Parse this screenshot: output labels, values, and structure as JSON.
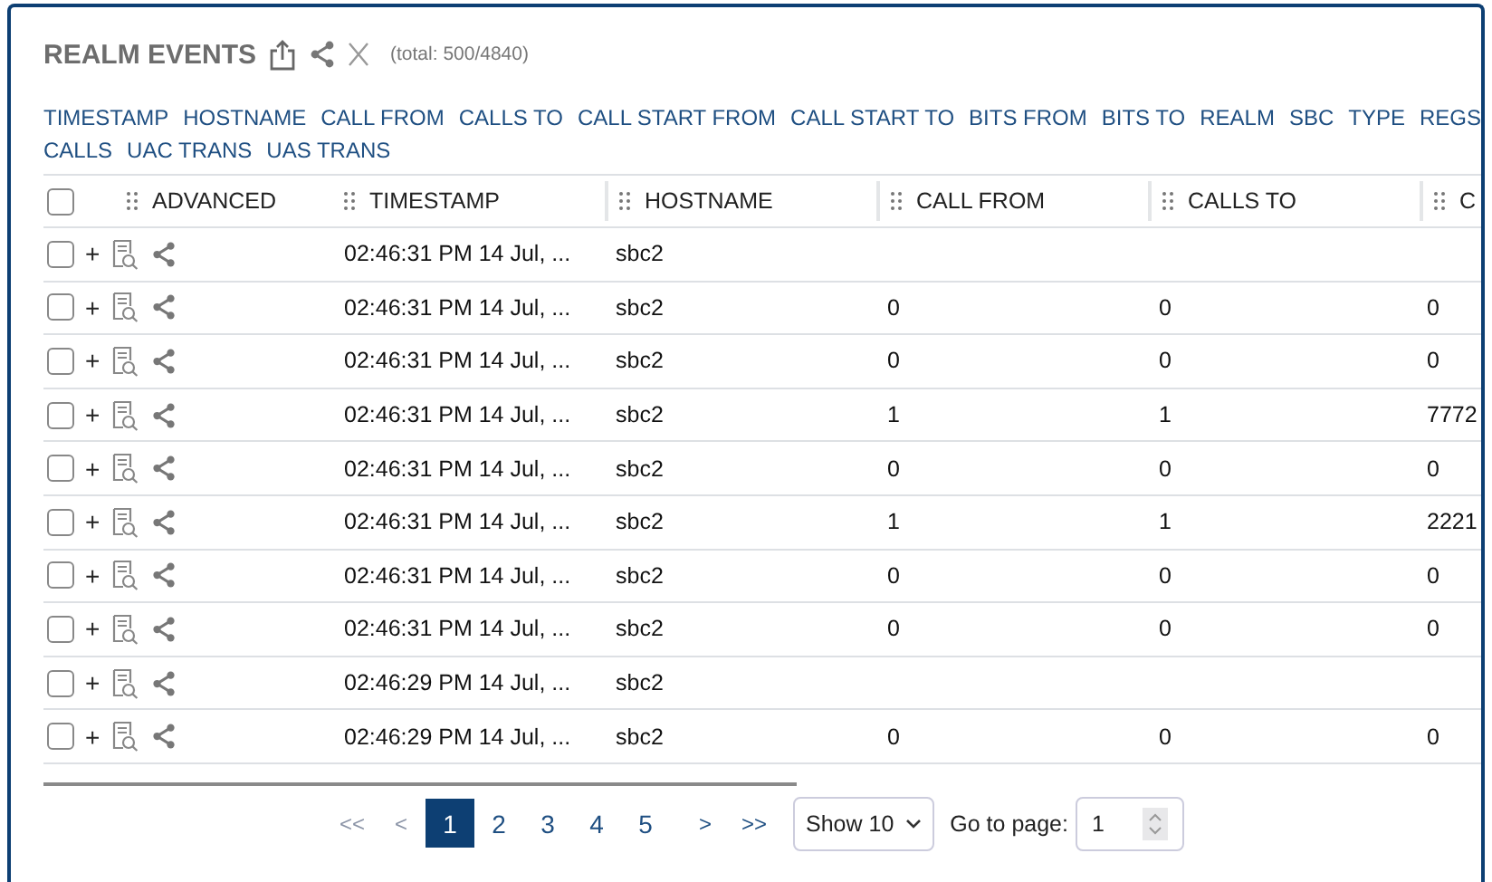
{
  "panel": {
    "title": "REALM EVENTS",
    "total": "(total: 500/4840)"
  },
  "column_picker": [
    "TIMESTAMP",
    "HOSTNAME",
    "CALL FROM",
    "CALLS TO",
    "CALL START FROM",
    "CALL START TO",
    "BITS FROM",
    "BITS TO",
    "REALM",
    "SBC",
    "TYPE",
    "REGS",
    "CALLS",
    "UAC TRANS",
    "UAS TRANS"
  ],
  "table": {
    "select_all": {
      "checked": false
    },
    "columns": [
      "ADVANCED",
      "TIMESTAMP",
      "HOSTNAME",
      "CALL FROM",
      "CALLS TO",
      "C"
    ],
    "rows": [
      {
        "checked": false,
        "expand": "+",
        "timestamp": "02:46:31 PM 14 Jul, ...",
        "hostname": "sbc2",
        "call_from": "",
        "calls_to": "",
        "column_6": ""
      },
      {
        "checked": false,
        "expand": "+",
        "timestamp": "02:46:31 PM 14 Jul, ...",
        "hostname": "sbc2",
        "call_from": "0",
        "calls_to": "0",
        "column_6": "0"
      },
      {
        "checked": false,
        "expand": "+",
        "timestamp": "02:46:31 PM 14 Jul, ...",
        "hostname": "sbc2",
        "call_from": "0",
        "calls_to": "0",
        "column_6": "0"
      },
      {
        "checked": false,
        "expand": "+",
        "timestamp": "02:46:31 PM 14 Jul, ...",
        "hostname": "sbc2",
        "call_from": "1",
        "calls_to": "1",
        "column_6": "7772"
      },
      {
        "checked": false,
        "expand": "+",
        "timestamp": "02:46:31 PM 14 Jul, ...",
        "hostname": "sbc2",
        "call_from": "0",
        "calls_to": "0",
        "column_6": "0"
      },
      {
        "checked": false,
        "expand": "+",
        "timestamp": "02:46:31 PM 14 Jul, ...",
        "hostname": "sbc2",
        "call_from": "1",
        "calls_to": "1",
        "column_6": "2221"
      },
      {
        "checked": false,
        "expand": "+",
        "timestamp": "02:46:31 PM 14 Jul, ...",
        "hostname": "sbc2",
        "call_from": "0",
        "calls_to": "0",
        "column_6": "0"
      },
      {
        "checked": false,
        "expand": "+",
        "timestamp": "02:46:31 PM 14 Jul, ...",
        "hostname": "sbc2",
        "call_from": "0",
        "calls_to": "0",
        "column_6": "0"
      },
      {
        "checked": false,
        "expand": "+",
        "timestamp": "02:46:29 PM 14 Jul, ...",
        "hostname": "sbc2",
        "call_from": "",
        "calls_to": "",
        "column_6": ""
      },
      {
        "checked": false,
        "expand": "+",
        "timestamp": "02:46:29 PM 14 Jul, ...",
        "hostname": "sbc2",
        "call_from": "0",
        "calls_to": "0",
        "column_6": "0"
      }
    ]
  },
  "pagination": {
    "first": "<<",
    "prev": "<",
    "pages": [
      {
        "label": "1",
        "selected": true
      },
      {
        "label": "2",
        "selected": false
      },
      {
        "label": "3",
        "selected": false
      },
      {
        "label": "4",
        "selected": false
      },
      {
        "label": "5",
        "selected": false
      }
    ],
    "next": ">",
    "last": ">>",
    "page_size": "Show 10",
    "goto_label": "Go to page:",
    "goto_value": "1"
  }
}
